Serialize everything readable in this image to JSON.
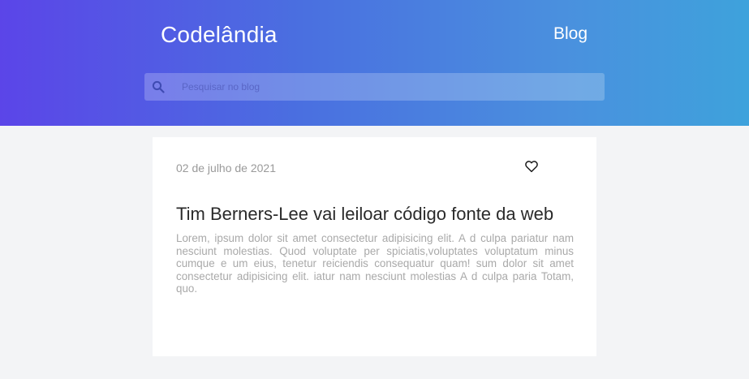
{
  "header": {
    "logo": "Codelândia",
    "nav": {
      "blog_label": "Blog"
    },
    "search": {
      "placeholder": "Pesquisar no blog",
      "value": ""
    }
  },
  "post": {
    "date": "02 de julho de 2021",
    "title": "Tim Berners-Lee vai leiloar código fonte da web",
    "excerpt": "Lorem, ipsum dolor sit amet consectetur adipisicing elit. A d culpa pariatur nam nesciunt molestias. Quod voluptate per spiciatis,voluptates voluptatum minus cumque e um eius, tenetur reiciendis consequatur quam! sum dolor sit amet consectetur adipisicing elit. iatur nam nesciunt molestias A d culpa paria Totam, quo.",
    "like_icon": "heart-icon"
  },
  "colors": {
    "gradient_start": "#5b45e8",
    "gradient_end": "#3ea2dc",
    "background": "#f3f4f6",
    "card": "#ffffff"
  }
}
